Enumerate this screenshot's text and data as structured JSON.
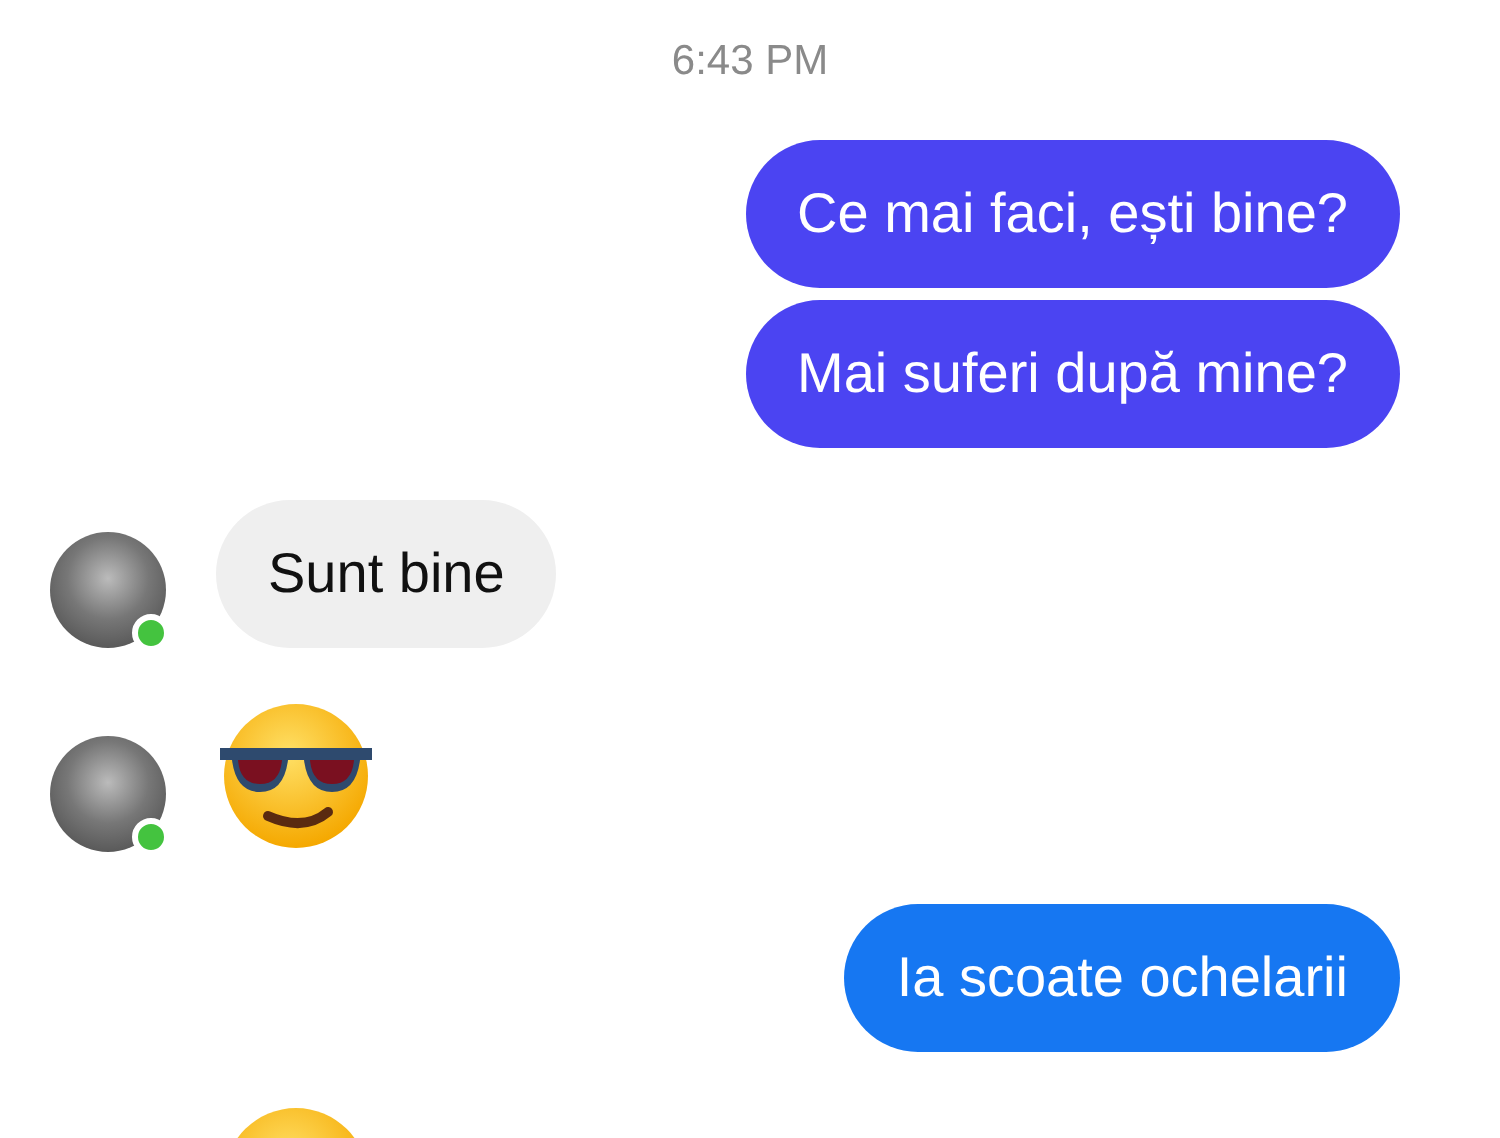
{
  "timestamp": "6:43 PM",
  "messages": [
    {
      "kind": "outgoing",
      "text": "Ce mai faci, ești bine?",
      "color": "#4b44f2"
    },
    {
      "kind": "outgoing",
      "text": "Mai suferi după mine?",
      "color": "#4b44f2"
    },
    {
      "kind": "incoming",
      "text": "Sunt bine",
      "color": "#efefef",
      "avatar": true
    },
    {
      "kind": "emoji",
      "avatar": true
    },
    {
      "kind": "outgoing",
      "text": "Ia scoate ochelarii",
      "color": "#1677f2"
    },
    {
      "kind": "emoji",
      "avatar": false
    }
  ]
}
